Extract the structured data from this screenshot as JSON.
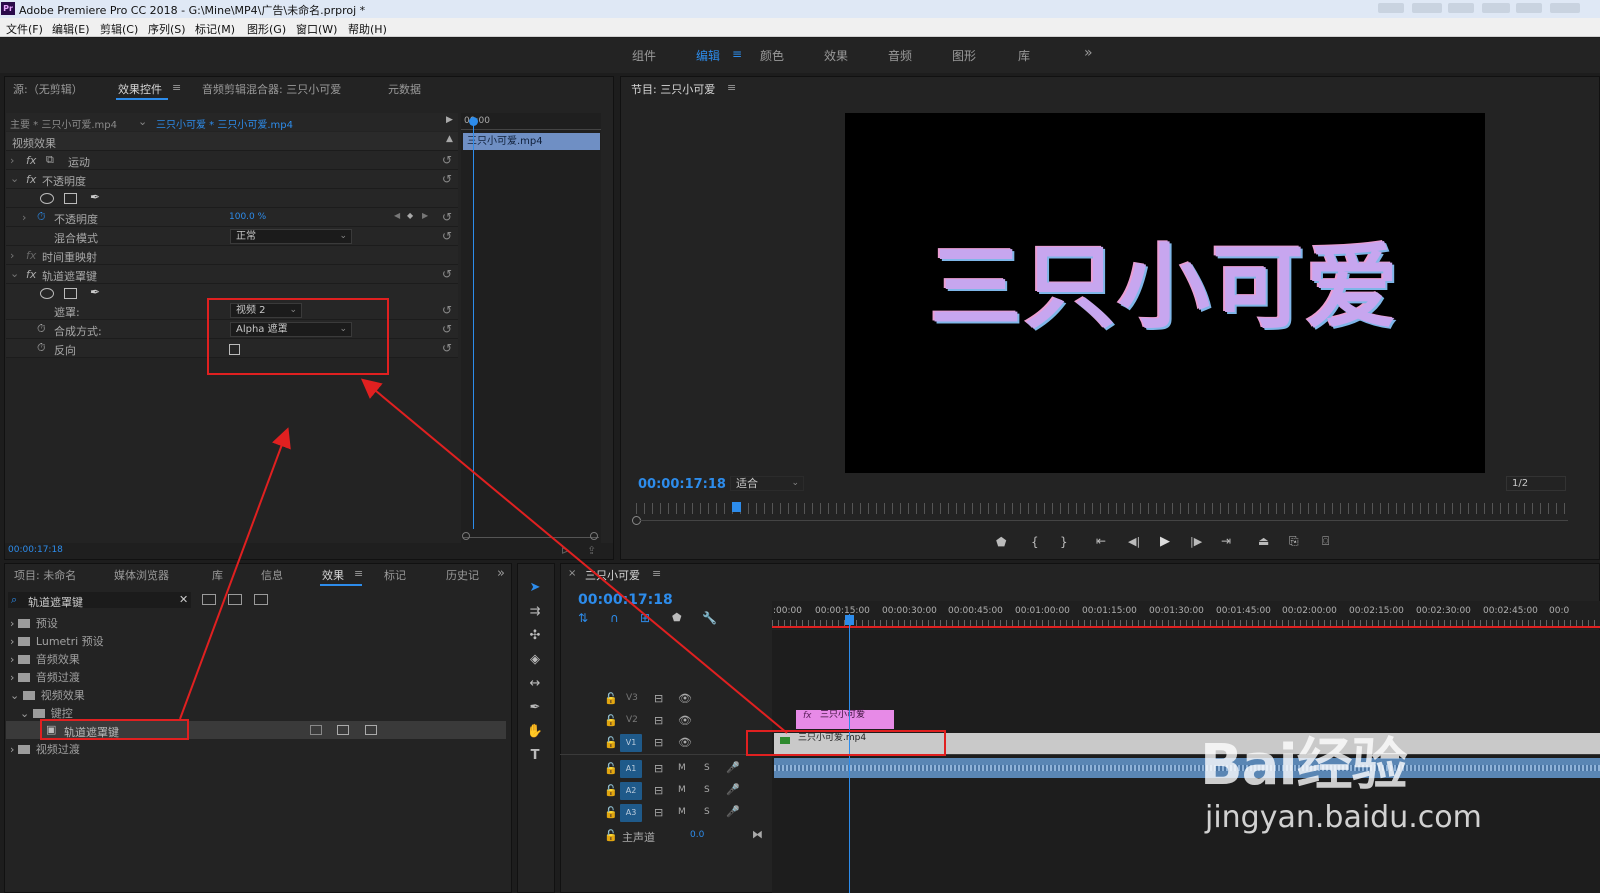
{
  "window": {
    "app_icon": "Pr",
    "title": "Adobe Premiere Pro CC 2018 - G:\\Mine\\MP4\\广告\\未命名.prproj *"
  },
  "menu": [
    "文件(F)",
    "编辑(E)",
    "剪辑(C)",
    "序列(S)",
    "标记(M)",
    "图形(G)",
    "窗口(W)",
    "帮助(H)"
  ],
  "workspaces": {
    "items": [
      "组件",
      "编辑",
      "颜色",
      "效果",
      "音频",
      "图形",
      "库"
    ],
    "active": "编辑",
    "more": "»",
    "menu_icon": "≡"
  },
  "source_panel": {
    "tabs": [
      "源:（无剪辑）",
      "效果控件",
      "音频剪辑混合器: 三只小可爱",
      "元数据"
    ],
    "active_tab": "效果控件",
    "master_label": "主要 * 三只小可爱.mp4",
    "clip_label": "三只小可爱 * 三只小可爱.mp4",
    "mini_timecode": "00:00",
    "mini_clip": "三只小可爱.mp4",
    "section_header": "视频效果",
    "rows": {
      "motion": "运动",
      "opacity": "不透明度",
      "opacity_param": "不透明度",
      "opacity_value": "100.0 %",
      "blend_mode_label": "混合模式",
      "blend_mode_value": "正常",
      "time_remap": "时间重映射",
      "track_matte": "轨道遮罩键",
      "matte_label": "遮罩:",
      "matte_value": "视频 2",
      "composite_label": "合成方式:",
      "composite_value": "Alpha 遮罩",
      "reverse_label": "反向"
    },
    "fx": "fx",
    "timecode": "00:00:17:18"
  },
  "program": {
    "title": "节目: 三只小可爱",
    "video_text": "三只小可爱",
    "timecode": "00:00:17:18",
    "fit": "适合",
    "resolution": "1/2"
  },
  "project_panel": {
    "tabs": [
      "项目: 未命名",
      "媒体浏览器",
      "库",
      "信息",
      "效果",
      "标记",
      "历史记"
    ],
    "active_tab": "效果",
    "more": "»",
    "search_value": "轨道遮罩键",
    "tree": [
      "预设",
      "Lumetri 预设",
      "音频效果",
      "音频过渡",
      "视频效果",
      "键控",
      "轨道遮罩键",
      "视频过渡"
    ]
  },
  "timeline": {
    "title": "三只小可爱",
    "timecode": "00:00:17:18",
    "ruler": [
      ":00:00",
      "00:00:15:00",
      "00:00:30:00",
      "00:00:45:00",
      "00:01:00:00",
      "00:01:15:00",
      "00:01:30:00",
      "00:01:45:00",
      "00:02:00:00",
      "00:02:15:00",
      "00:02:30:00",
      "00:02:45:00",
      "00:0"
    ],
    "video_tracks": [
      "V3",
      "V2",
      "V1"
    ],
    "audio_tracks": [
      "A1",
      "A2",
      "A3"
    ],
    "mute": "M",
    "solo": "S",
    "master_label": "主声道",
    "master_value": "0.0",
    "clip_v2": "三只小可爱",
    "clip_v1": "三只小可爱.mp4"
  },
  "watermark": {
    "brand": "Bai经验",
    "url": "jingyan.baidu.com"
  },
  "colors": {
    "accent": "#2d8ceb",
    "annotation": "#e02020",
    "graphic_clip": "#e78ae7",
    "audio_clip": "#5a86b4"
  }
}
